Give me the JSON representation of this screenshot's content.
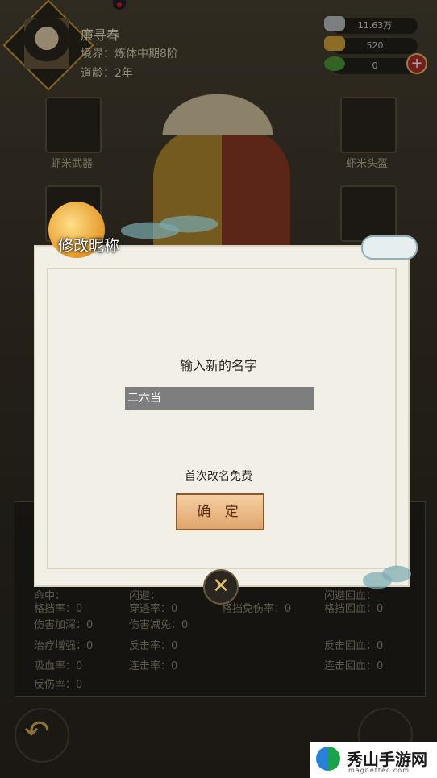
{
  "player": {
    "name": "廉寻春",
    "realm": "境界：炼体中期8阶",
    "age": "道龄：2年"
  },
  "resources": [
    {
      "icon": "silver-ingot-icon",
      "value": "11.63万"
    },
    {
      "icon": "gold-ingot-icon",
      "value": "520"
    },
    {
      "icon": "jade-gem-icon",
      "value": "0"
    }
  ],
  "equipment": {
    "weapon_label": "虾米武器",
    "helmet_label": "虾米头盔"
  },
  "stats": {
    "rows": [
      [
        "命中：",
        "闪避：",
        "闪避回血："
      ],
      [
        "格挡率：0",
        "穿透率：0",
        "格挡免伤率：0",
        "格挡回血：0"
      ],
      [
        "伤害加深：0",
        "伤害减免：0"
      ],
      [
        "治疗增强：0",
        "反击率：0",
        "反击回血：0"
      ],
      [
        "吸血率：0",
        "连击率：0",
        "连击回血：0"
      ],
      [
        "反伤率：0"
      ]
    ]
  },
  "dialog": {
    "title": "修改昵称",
    "prompt": "输入新的名字",
    "input_value": "二六当",
    "free_note": "首次改名免费",
    "confirm_label": "确 定",
    "close_label": "✕"
  },
  "watermark": {
    "title": "秀山手游网",
    "subtitle": "magnettec.com"
  },
  "colors": {
    "dialog_bg": "#f2efe6",
    "confirm_bg": "#e9b57c",
    "input_bg": "#7e7e7e",
    "accent_gold": "#c89a3a"
  }
}
